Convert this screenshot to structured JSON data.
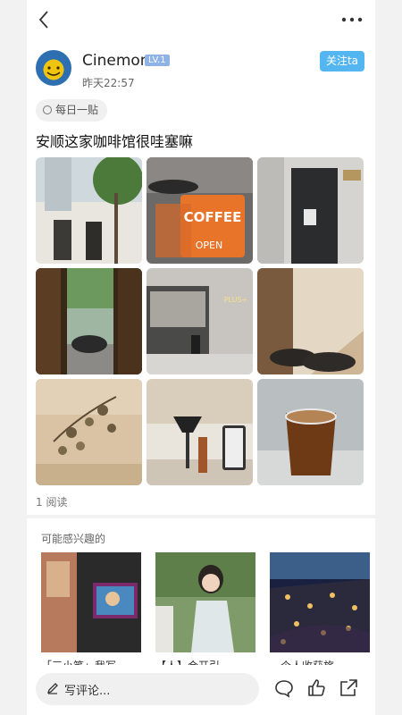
{
  "post": {
    "username": "Cinemon",
    "level": "LV.1",
    "time": "昨天22:57",
    "follow_label": "关注ta",
    "topic_tag": "每日一贴",
    "title": "安顺这家咖啡馆很哇塞嘛",
    "reads": "1 阅读",
    "photo_texts": {
      "coffee_sign": "COFFEE",
      "open_sign": "OPEN",
      "plus_sign": "PLUS+"
    }
  },
  "recommend": {
    "title": "可能感兴趣的",
    "captions": [
      "「三小笔」我写",
      "【人】合开引",
      "一个人收获旅"
    ]
  },
  "bottom": {
    "comment_placeholder": "写评论..."
  },
  "icons": [
    "back-icon",
    "more-icon",
    "comment-icon",
    "like-icon",
    "share-icon",
    "pen-icon",
    "tag-icon"
  ],
  "colors": {
    "follow": "#54b6f0",
    "level_badge": "#8fb3e6"
  }
}
